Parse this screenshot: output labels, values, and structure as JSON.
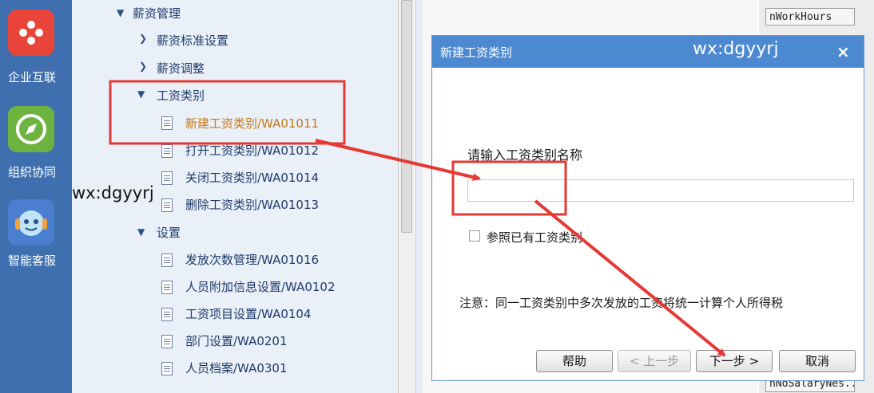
{
  "rail": {
    "items": [
      {
        "label": "企业互联",
        "icon": "enterprise-link-icon",
        "color": "#e8443a"
      },
      {
        "label": "组织协同",
        "icon": "compass-icon",
        "color": "#6db33f"
      },
      {
        "label": "智能客服",
        "icon": "headset-robot-icon",
        "color": "#4a7fd0"
      }
    ]
  },
  "tree": {
    "root": "薪资管理",
    "nodes": [
      {
        "label": "薪资标准设置"
      },
      {
        "label": "薪资调整"
      },
      {
        "label": "工资类别"
      },
      {
        "label": "新建工资类别/WA01011"
      },
      {
        "label": "打开工资类别/WA01012"
      },
      {
        "label": "关闭工资类别/WA01014"
      },
      {
        "label": "删除工资类别/WA01013"
      },
      {
        "label": "设置"
      },
      {
        "label": "发放次数管理/WA01016"
      },
      {
        "label": "人员附加信息设置/WA0102"
      },
      {
        "label": "工资项目设置/WA0104"
      },
      {
        "label": "部门设置/WA0201"
      },
      {
        "label": "人员档案/WA0301"
      }
    ]
  },
  "watermark": "wx:dgyyrj",
  "background_grid": {
    "top_cell": "nWorkHours",
    "bottom_cell": "nNoSalaryNes..."
  },
  "dialog": {
    "title": "新建工资类别",
    "watermark": "wx:dgyyrj",
    "close": "×",
    "prompt": "请输入工资类别名称",
    "input_value": "",
    "checkbox_label": "参照已有工资类别",
    "checkbox_checked": false,
    "note": "注意：同一工资类别中多次发放的工资将统一计算个人所得税",
    "buttons": {
      "help": "帮助",
      "prev": "< 上一步",
      "next": "下一步 >",
      "cancel": "取消"
    }
  },
  "colors": {
    "rail": "#3f6fae",
    "title_bar": "#4d89d0",
    "annotation": "#e53935",
    "selected_text": "#c5781a"
  }
}
